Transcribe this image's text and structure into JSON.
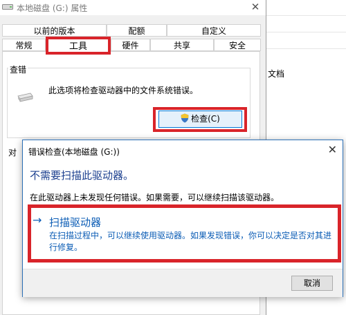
{
  "background_window": {
    "text": "文档"
  },
  "properties_dialog": {
    "title": "本地磁盘 (G:) 属性",
    "close_glyph": "✕",
    "tabs_row1": [
      "以前的版本",
      "配额",
      "自定义"
    ],
    "tabs_row2": [
      "常规",
      "工具",
      "硬件",
      "共享",
      "安全"
    ],
    "active_tab": "工具",
    "check_group": {
      "label": "查错",
      "description": "此选项将检查驱动器中的文件系统错误。",
      "button_label": "检查(C)"
    },
    "second_group_partial_label": "对"
  },
  "error_check_dialog": {
    "title": "错误检查(本地磁盘 (G:))",
    "close_glyph": "✕",
    "heading": "不需要扫描此驱动器。",
    "body": "在此驱动器上未发现任何错误。如果需要，可以继续扫描该驱动器。",
    "scan_option": {
      "arrow": "→",
      "title": "扫描驱动器",
      "description": "在扫描过程中，可以继续使用驱动器。如果发现错误，你可以决定是否对其进行修复。"
    },
    "cancel_label": "取消"
  },
  "colors": {
    "highlight": "#d9242a",
    "link": "#0b5cb5",
    "heading": "#1b3f8f"
  },
  "icons": {
    "drive": "drive-icon",
    "hdd": "hdd-icon",
    "shield": "uac-shield-icon"
  }
}
